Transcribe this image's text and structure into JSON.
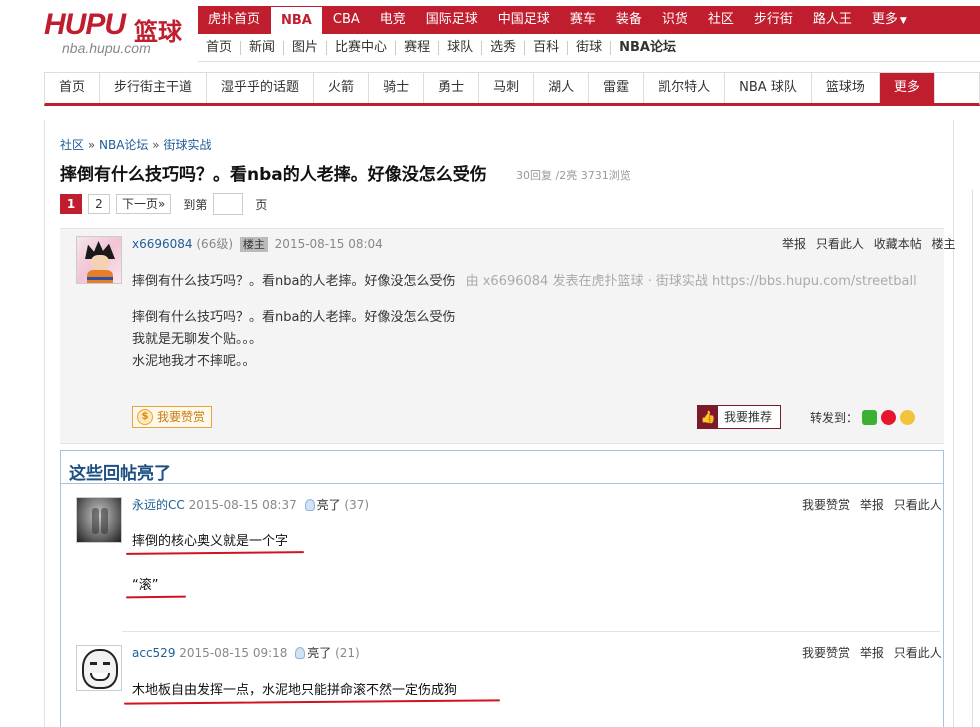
{
  "logo": {
    "brand": "HUPU",
    "brand_cn": "篮球",
    "domain": "nba.hupu.com"
  },
  "main_nav": [
    {
      "label": "虎扑首页",
      "active": false
    },
    {
      "label": "NBA",
      "active": true
    },
    {
      "label": "CBA",
      "active": false
    },
    {
      "label": "电竞",
      "active": false
    },
    {
      "label": "国际足球",
      "active": false
    },
    {
      "label": "中国足球",
      "active": false
    },
    {
      "label": "赛车",
      "active": false
    },
    {
      "label": "装备",
      "active": false
    },
    {
      "label": "识货",
      "active": false
    },
    {
      "label": "社区",
      "active": false
    },
    {
      "label": "步行街",
      "active": false
    },
    {
      "label": "路人王",
      "active": false
    },
    {
      "label": "更多",
      "active": false
    }
  ],
  "sub_nav": [
    "首页",
    "新闻",
    "图片",
    "比赛中心",
    "赛程",
    "球队",
    "选秀",
    "百科",
    "街球",
    "NBA论坛"
  ],
  "sec_nav": [
    "首页",
    "步行街主干道",
    "湿乎乎的话题",
    "火箭",
    "骑士",
    "勇士",
    "马刺",
    "湖人",
    "雷霆",
    "凯尔特人",
    "NBA 球队",
    "篮球场",
    "更多"
  ],
  "breadcrumb": {
    "root": "社区",
    "sep": "»",
    "forum": "NBA论坛",
    "board": "街球实战"
  },
  "thread": {
    "title": "摔倒有什么技巧吗？。看nba的人老摔。好像没怎么受伤",
    "meta": "30回复 /2亮  3731浏览"
  },
  "pager": {
    "pages": [
      "1",
      "2"
    ],
    "next": "下一页»",
    "goto_label": "到第",
    "page_suffix": "页"
  },
  "op": {
    "username": "x6696084",
    "level": "(66级)",
    "badge": "楼主",
    "time": "2015-08-15 08:04",
    "actions": [
      "举报",
      "只看此人",
      "收藏本帖",
      "楼主"
    ],
    "line1": "摔倒有什么技巧吗？。看nba的人老摔。好像没怎么受伤",
    "source": "由  x6696084 发表在虎扑篮球 · 街球实战 https://bbs.hupu.com/streetball",
    "body": [
      "摔倒有什么技巧吗？。看nba的人老摔。好像没怎么受伤",
      "我就是无聊发个贴。。。",
      "水泥地我才不摔呢。。"
    ],
    "praise_label": "我要赞赏",
    "praise_icon_glyph": "$",
    "recommend_label": "我要推荐",
    "recommend_icon_glyph": "👍",
    "share_label": "转发到："
  },
  "highlight": {
    "title": "这些回帖亮了",
    "replies": [
      {
        "username": "永远的CC",
        "time": "2015-08-15 08:37",
        "liang": "亮了",
        "count": "(37)",
        "actions": [
          "我要赞赏",
          "举报",
          "只看此人"
        ],
        "lines": [
          "摔倒的核心奥义就是一个字",
          "“滚”"
        ]
      },
      {
        "username": "acc529",
        "time": "2015-08-15 09:18",
        "liang": "亮了",
        "count": "(21)",
        "actions": [
          "我要赞赏",
          "举报",
          "只看此人"
        ],
        "lines": [
          "木地板自由发挥一点，水泥地只能拼命滚不然一定伤成狗"
        ]
      }
    ]
  },
  "colors": {
    "brand_red": "#c01e2f",
    "link_blue": "#1f5c99",
    "highlight_title": "#1f4f82",
    "annotation_red": "#d0141f"
  }
}
